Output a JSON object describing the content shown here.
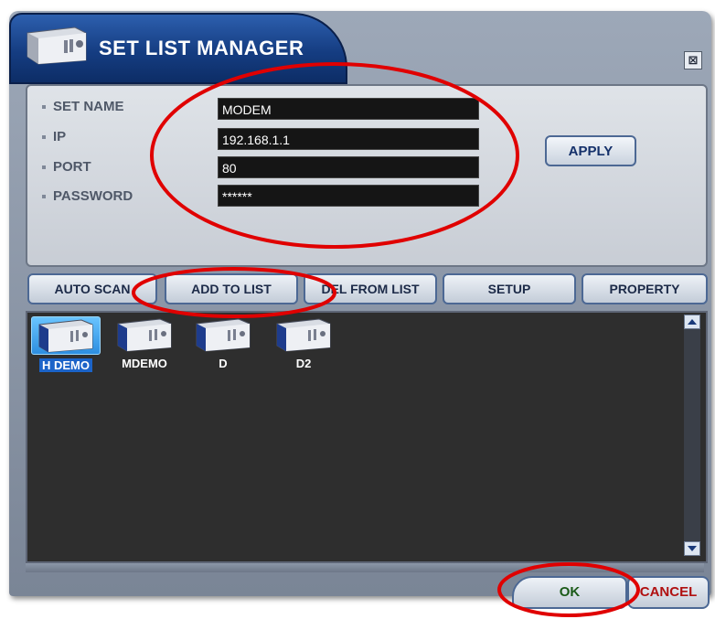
{
  "dialog": {
    "title": "SET LIST MANAGER",
    "close_symbol": "⊠"
  },
  "form": {
    "fields": [
      {
        "label": "SET NAME",
        "value": "MODEM"
      },
      {
        "label": "IP",
        "value": "192.168.1.1"
      },
      {
        "label": "PORT",
        "value": "80"
      },
      {
        "label": "PASSWORD",
        "value": "******"
      }
    ],
    "apply_label": "APPLY"
  },
  "toolbar": {
    "auto_scan": "AUTO SCAN",
    "add_to_list": "ADD TO LIST",
    "del_from_list": "DEL FROM LIST",
    "setup": "SETUP",
    "property": "PROPERTY"
  },
  "set_list": {
    "items": [
      {
        "label": "H DEMO",
        "selected": true
      },
      {
        "label": "MDEMO",
        "selected": false
      },
      {
        "label": "D",
        "selected": false
      },
      {
        "label": "D2",
        "selected": false
      }
    ]
  },
  "footer": {
    "ok_label": "OK",
    "cancel_label": "CANCEL"
  },
  "colors": {
    "title_bar": "#153d82",
    "annotation_circle": "#e00000",
    "selected_item": "#2d8ee0"
  },
  "icons": {
    "title_icon": "dvr-device-icon",
    "item_icon": "dvr-device-icon"
  }
}
